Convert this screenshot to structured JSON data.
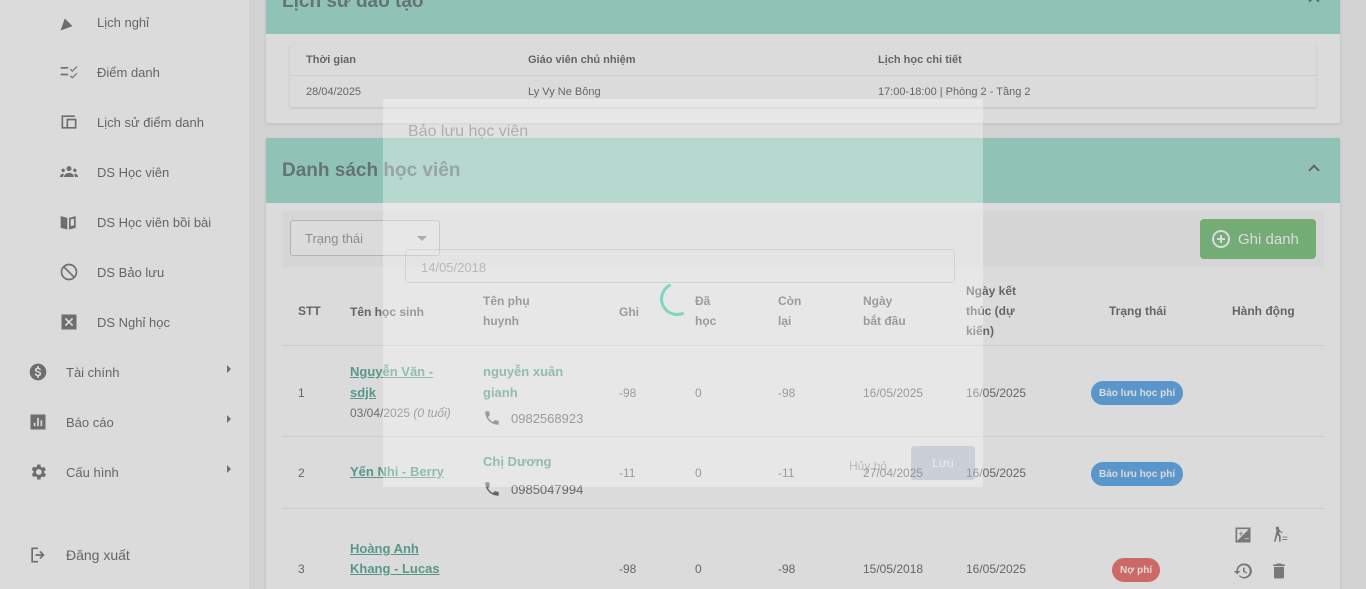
{
  "sidebar": {
    "items": [
      {
        "label": "Lịch nghỉ",
        "icon": "party-icon"
      },
      {
        "label": "Điểm danh",
        "icon": "checklist-icon"
      },
      {
        "label": "Lịch sử điểm danh",
        "icon": "history-attendance-icon"
      },
      {
        "label": "DS Học viên",
        "icon": "people-icon"
      },
      {
        "label": "DS Học viên bồi bài",
        "icon": "book-icon"
      },
      {
        "label": "DS Bảo lưu",
        "icon": "block-icon"
      },
      {
        "label": "DS Nghỉ học",
        "icon": "close-box-icon"
      }
    ],
    "groups": [
      {
        "label": "Tài chính",
        "icon": "money-icon"
      },
      {
        "label": "Báo cáo",
        "icon": "chart-icon"
      },
      {
        "label": "Cấu hình",
        "icon": "gear-icon"
      }
    ],
    "logout_label": "Đăng xuất"
  },
  "history_panel": {
    "title": "Lịch sử đào tạo",
    "columns": [
      "Thời gian",
      "Giáo viên chủ nhiệm",
      "Lịch học chi tiết"
    ],
    "rows": [
      {
        "time": "28/04/2025",
        "teacher": "Ly Vy Ne Bông",
        "schedule": "17:00-18:00 | Phòng 2 - Tầng 2"
      }
    ]
  },
  "students_panel": {
    "title": "Danh sách học viên",
    "status_filter_placeholder": "Trạng thái",
    "enroll_label": "Ghi danh",
    "columns": {
      "stt": "STT",
      "name": "Tên học sinh",
      "parent_1": "Tên phụ",
      "parent_2": "huynh",
      "ghi": "Ghi",
      "learned_1": "Đã",
      "learned_2": "học",
      "remaining_1": "Còn",
      "remaining_2": "lại",
      "start_1": "Ngày",
      "start_2": "bắt đầu",
      "end_1": "Ngày kết",
      "end_2": "thúc (dự",
      "end_3": "kiến)",
      "status": "Trạng thái",
      "action": "Hành động"
    },
    "rows": [
      {
        "stt": "1",
        "name_1": "Nguyễn Văn -",
        "name_2": "sdjk",
        "dob": "03/04/2025",
        "age": "(0 tuổi)",
        "parent_1": "nguyễn xuân",
        "parent_2": "gianh",
        "phone": "0982568923",
        "ghi": "-98",
        "learned": "0",
        "remaining": "-98",
        "start": "16/05/2025",
        "end": "16/05/2025",
        "status": "Bảo lưu học phí",
        "status_color": "#1e88e5"
      },
      {
        "stt": "2",
        "name_1": "Yến Nhi - Berry",
        "parent_1": "Chị Dương",
        "phone": "0985047994",
        "ghi": "-11",
        "learned": "0",
        "remaining": "-11",
        "start": "27/04/2025",
        "end": "16/05/2025",
        "status": "Bảo lưu học phí",
        "status_color": "#1e88e5"
      },
      {
        "stt": "3",
        "name_1": "Hoàng Anh",
        "name_2": "Khang - Lucas",
        "ghi": "-98",
        "learned": "0",
        "remaining": "-98",
        "start": "15/05/2018",
        "end": "16/05/2025",
        "status": "Nợ phí",
        "status_color": "#e53935"
      }
    ]
  },
  "dialog": {
    "title": "Bảo lưu học viên",
    "date_value": "14/05/2018",
    "cancel_label": "Hủy bỏ",
    "save_label": "Lưu"
  },
  "colors": {
    "accent": "#7fd6c0",
    "enroll": "#4caf50",
    "link": "#1e8a6e"
  }
}
